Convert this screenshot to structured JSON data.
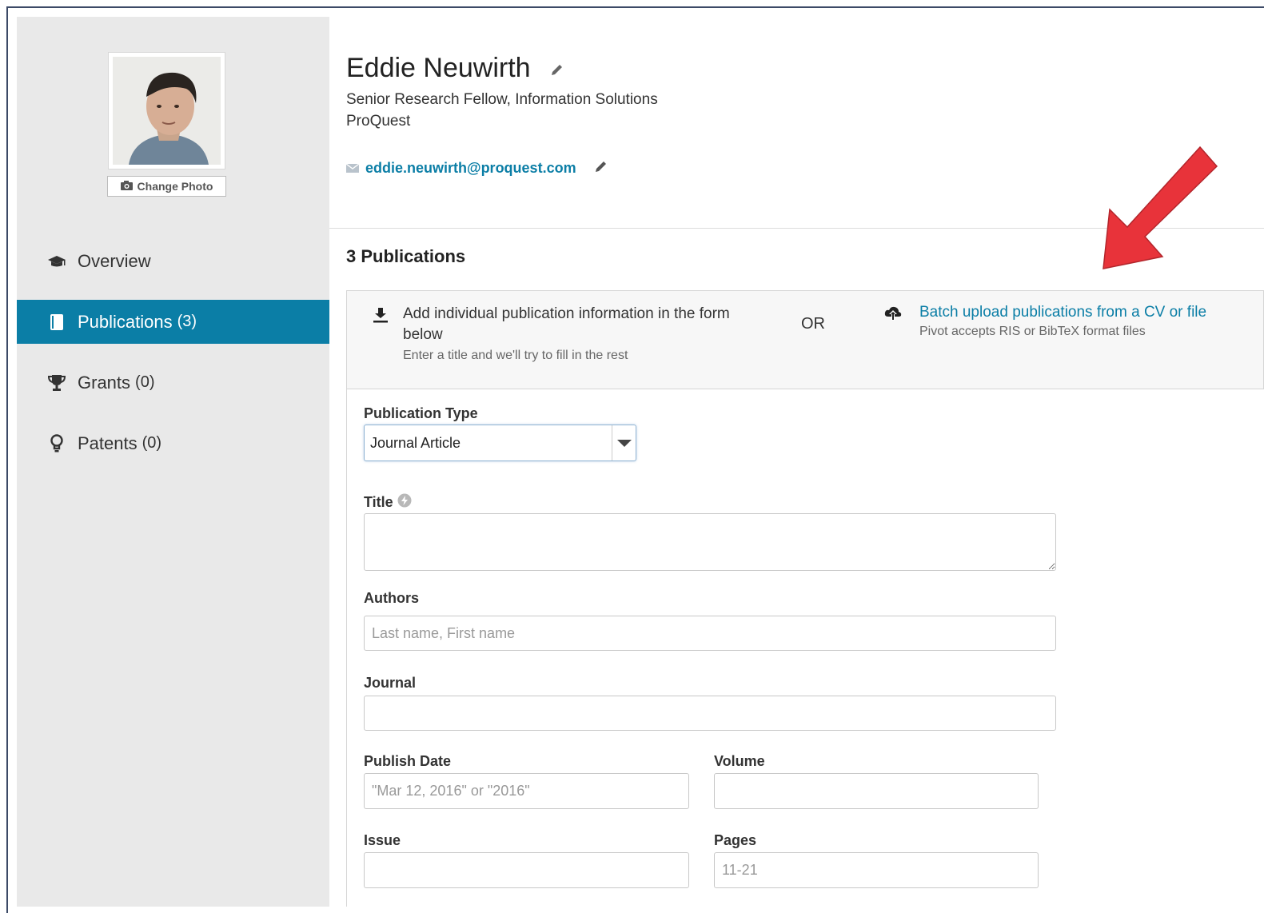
{
  "profile": {
    "name": "Eddie Neuwirth",
    "title": "Senior Research Fellow, Information Solutions",
    "organization": "ProQuest",
    "email": "eddie.neuwirth@proquest.com",
    "change_photo_label": "Change Photo"
  },
  "sidebar": {
    "items": [
      {
        "label": "Overview",
        "count": "",
        "icon": "graduation-cap-icon",
        "active": false
      },
      {
        "label": "Publications",
        "count": "(3)",
        "icon": "book-icon",
        "active": true
      },
      {
        "label": "Grants",
        "count": "(0)",
        "icon": "trophy-icon",
        "active": false
      },
      {
        "label": "Patents",
        "count": "(0)",
        "icon": "lightbulb-icon",
        "active": false
      }
    ]
  },
  "publications": {
    "heading": "3 Publications",
    "add_individual": {
      "text": "Add individual publication information in the form below",
      "sub": "Enter a title and we'll try to fill in the rest"
    },
    "or_label": "OR",
    "batch": {
      "link": "Batch upload publications from a CV or file",
      "sub": "Pivot accepts RIS or BibTeX format files"
    }
  },
  "form": {
    "publication_type": {
      "label": "Publication Type",
      "value": "Journal Article"
    },
    "title": {
      "label": "Title",
      "value": ""
    },
    "authors": {
      "label": "Authors",
      "placeholder": "Last name, First name"
    },
    "journal": {
      "label": "Journal",
      "value": ""
    },
    "publish_date": {
      "label": "Publish Date",
      "placeholder": "\"Mar 12, 2016\" or \"2016\""
    },
    "volume": {
      "label": "Volume",
      "value": ""
    },
    "issue": {
      "label": "Issue",
      "value": ""
    },
    "pages": {
      "label": "Pages",
      "placeholder": "11-21"
    }
  },
  "colors": {
    "accent": "#0b7ea6",
    "sidebar_bg": "#e9e9e9",
    "annotation_arrow": "#e8333a"
  }
}
